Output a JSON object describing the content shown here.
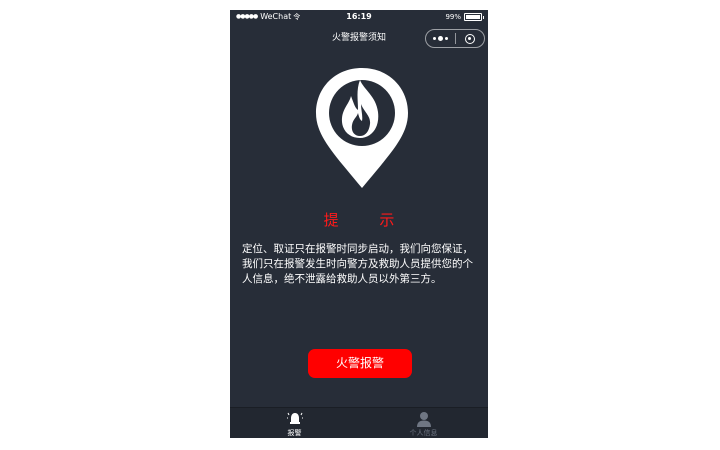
{
  "status_bar": {
    "signal": "●●●●●",
    "carrier": "WeChat",
    "wifi": "令",
    "time": "16:19",
    "battery": "99%"
  },
  "nav": {
    "title": "火警报警须知"
  },
  "prompt": {
    "title": "提 示",
    "notice": "定位、取证只在报警时同步启动，我们向您保证，我们只在报警发生时向警方及救助人员提供您的个人信息，绝不泄露给救助人员以外第三方。"
  },
  "actions": {
    "alarm_button": "火警报警"
  },
  "tabbar": {
    "tabs": [
      {
        "label": "报警",
        "icon": "alarm-bell-icon",
        "active": true
      },
      {
        "label": "个人信息",
        "icon": "person-icon",
        "active": false
      }
    ]
  },
  "colors": {
    "background": "#272d38",
    "accent": "#ff0000",
    "text": "#ffffff"
  }
}
